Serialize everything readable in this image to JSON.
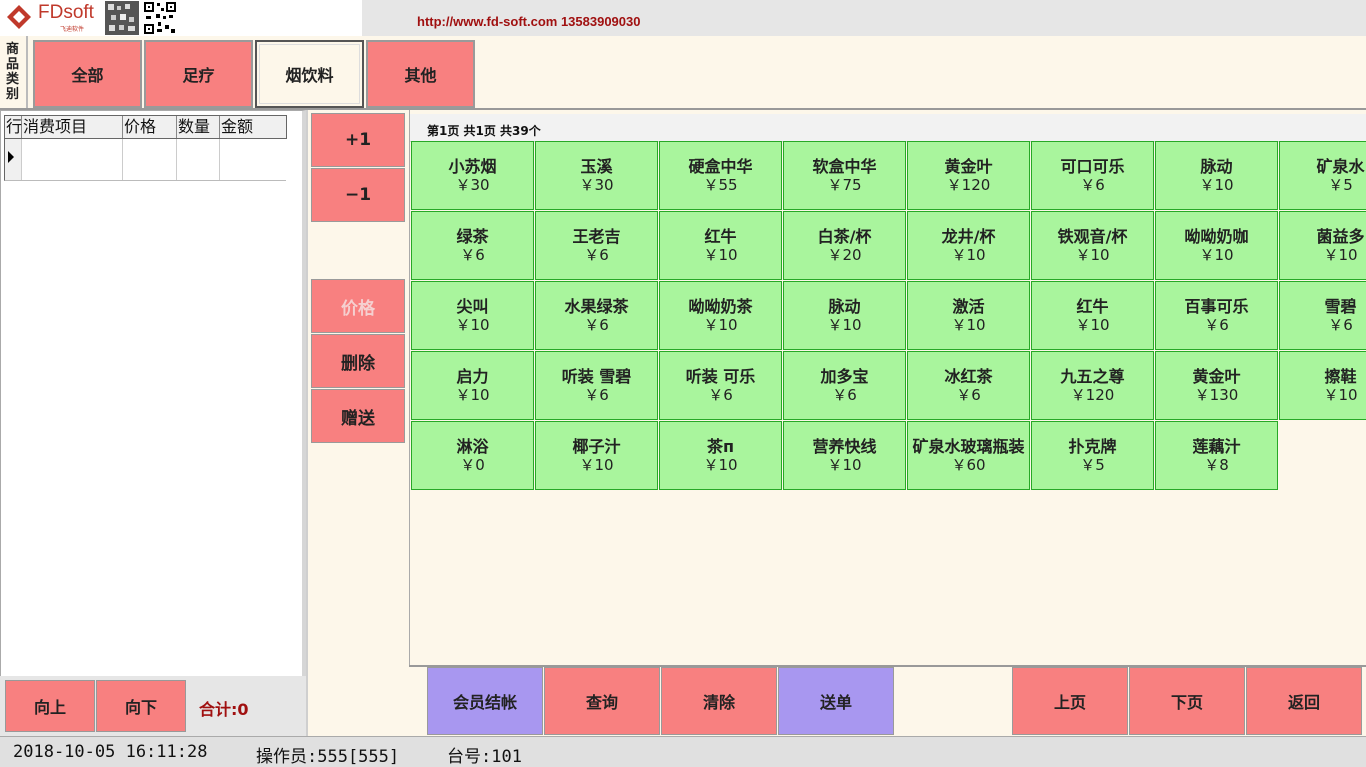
{
  "header": {
    "logo_text": "FDsoft",
    "logo_subtitle": "飞迪软件",
    "url_text": "http://www.fd-soft.com  13583909030"
  },
  "categories": {
    "label": "商品类别",
    "items": [
      {
        "label": "全部"
      },
      {
        "label": "足疗"
      },
      {
        "label": "烟饮料",
        "active": true
      },
      {
        "label": "其他"
      }
    ]
  },
  "order_table": {
    "columns": [
      "行",
      "消费项目",
      "价格",
      "数量",
      "金额"
    ]
  },
  "order_nav": {
    "up_label": "向上",
    "down_label": "向下",
    "total_label": "合计:0"
  },
  "middle_buttons": {
    "plus_label": "+1",
    "minus_label": "−1",
    "price_label": "价格",
    "delete_label": "删除",
    "gift_label": "赠送"
  },
  "products": {
    "page_info": "第1页  共1页  共39个",
    "items": [
      {
        "name": "小苏烟",
        "price": "￥30"
      },
      {
        "name": "玉溪",
        "price": "￥30"
      },
      {
        "name": "硬盒中华",
        "price": "￥55"
      },
      {
        "name": "软盒中华",
        "price": "￥75"
      },
      {
        "name": "黄金叶",
        "price": "￥120"
      },
      {
        "name": "可口可乐",
        "price": "￥6"
      },
      {
        "name": "脉动",
        "price": "￥10"
      },
      {
        "name": "矿泉水",
        "price": "￥5"
      },
      {
        "name": "绿茶",
        "price": "￥6"
      },
      {
        "name": "王老吉",
        "price": "￥6"
      },
      {
        "name": "红牛",
        "price": "￥10"
      },
      {
        "name": "白茶/杯",
        "price": "￥20"
      },
      {
        "name": "龙井/杯",
        "price": "￥10"
      },
      {
        "name": "铁观音/杯",
        "price": "￥10"
      },
      {
        "name": "呦呦奶咖",
        "price": "￥10"
      },
      {
        "name": "菌益多",
        "price": "￥10"
      },
      {
        "name": "尖叫",
        "price": "￥10"
      },
      {
        "name": "水果绿茶",
        "price": "￥6"
      },
      {
        "name": "呦呦奶茶",
        "price": "￥10"
      },
      {
        "name": "脉动",
        "price": "￥10"
      },
      {
        "name": "激活",
        "price": "￥10"
      },
      {
        "name": "红牛",
        "price": "￥10"
      },
      {
        "name": "百事可乐",
        "price": "￥6"
      },
      {
        "name": "雪碧",
        "price": "￥6"
      },
      {
        "name": "启力",
        "price": "￥10"
      },
      {
        "name": "听装  雪碧",
        "price": "￥6"
      },
      {
        "name": "听装  可乐",
        "price": "￥6"
      },
      {
        "name": "加多宝",
        "price": "￥6"
      },
      {
        "name": "冰红茶",
        "price": "￥6"
      },
      {
        "name": "九五之尊",
        "price": "￥120"
      },
      {
        "name": "黄金叶",
        "price": "￥130"
      },
      {
        "name": "擦鞋",
        "price": "￥10"
      },
      {
        "name": "淋浴",
        "price": "￥0"
      },
      {
        "name": "椰子汁",
        "price": "￥10"
      },
      {
        "name": "茶п",
        "price": "￥10"
      },
      {
        "name": "营养快线",
        "price": "￥10"
      },
      {
        "name": "矿泉水玻璃瓶装",
        "price": "￥60"
      },
      {
        "name": "扑克牌",
        "price": "￥5"
      },
      {
        "name": "莲藕汁",
        "price": "￥8"
      }
    ]
  },
  "actions": {
    "member_checkout_label": "会员结帐",
    "query_label": "查询",
    "clear_label": "清除",
    "send_order_label": "送单",
    "prev_page_label": "上页",
    "next_page_label": "下页",
    "back_label": "返回"
  },
  "status": {
    "datetime": "2018-10-05 16:11:28",
    "operator": "操作员:555[555]",
    "table_no": "台号:101"
  },
  "colors": {
    "red_button": "#f88080",
    "purple_button": "#a897f0",
    "green_tile": "#a9f59d",
    "background": "#fdf7ea"
  }
}
